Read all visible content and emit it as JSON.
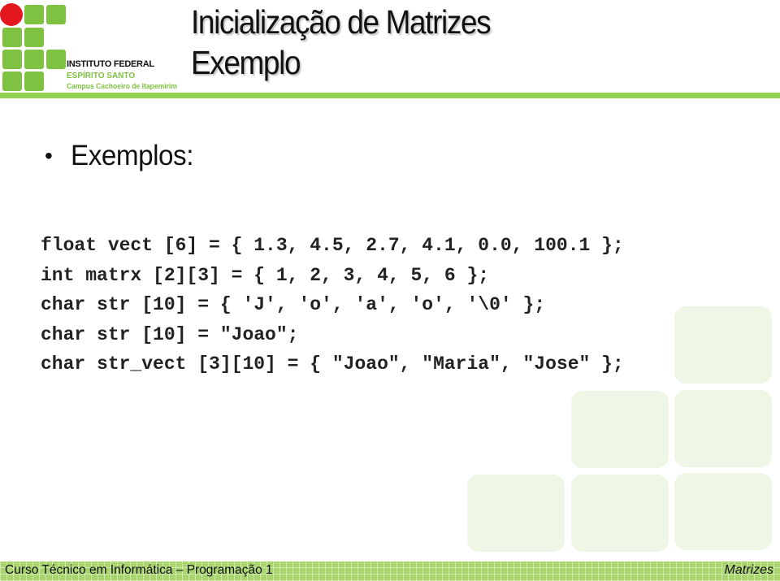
{
  "logo": {
    "line1": "INSTITUTO FEDERAL",
    "line2": "ESPÍRITO SANTO",
    "line3": "Campus Cachoeiro de Itapemirim",
    "colors": {
      "green": "#7fc141",
      "red": "#e2181e"
    }
  },
  "slide": {
    "title_line1": "Inicialização de Matrizes",
    "title_line2": "Exemplo",
    "bullet": "Exemplos:",
    "code": [
      "float vect [6] = { 1.3, 4.5, 2.7, 4.1, 0.0, 100.1 };",
      "int matrx [2][3] = { 1, 2, 3, 4, 5, 6 };",
      "char str [10] = { 'J', 'o', 'a', 'o', '\\0' };",
      "char str [10] = \"Joao\";",
      "char str_vect [3][10] = { \"Joao\", \"Maria\", \"Jose\" };"
    ]
  },
  "footer": {
    "course": "Curso Técnico em Informática – Programação 1",
    "topic": "Matrizes"
  },
  "colors": {
    "accent": "#92d050",
    "tile": "#eef6e6"
  }
}
